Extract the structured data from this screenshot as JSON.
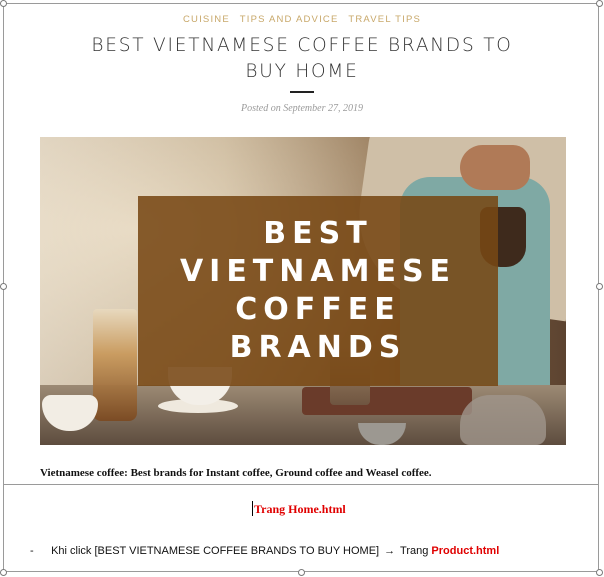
{
  "categories": [
    "CUISINE",
    "TIPS AND ADVICE",
    "TRAVEL TIPS"
  ],
  "post": {
    "title_line1": "BEST VIETNAMESE COFFEE BRANDS TO",
    "title_line2": "BUY HOME",
    "date": "Posted on September 27, 2019"
  },
  "hero": {
    "overlay_lines": [
      "BEST",
      "VIETNAMESE",
      "COFFEE",
      "BRANDS"
    ]
  },
  "excerpt": "Vietnamese coffee: Best brands for Instant coffee, Ground coffee and Weasel coffee.",
  "notes": {
    "page_name": "Trang Home.html",
    "bullet_dash": "-",
    "bullet_text": "Khi click [BEST VIETNAMESE COFFEE BRANDS TO BUY HOME]",
    "arrow": "→",
    "bullet_trang": "Trang",
    "bullet_target": "Product.html"
  }
}
